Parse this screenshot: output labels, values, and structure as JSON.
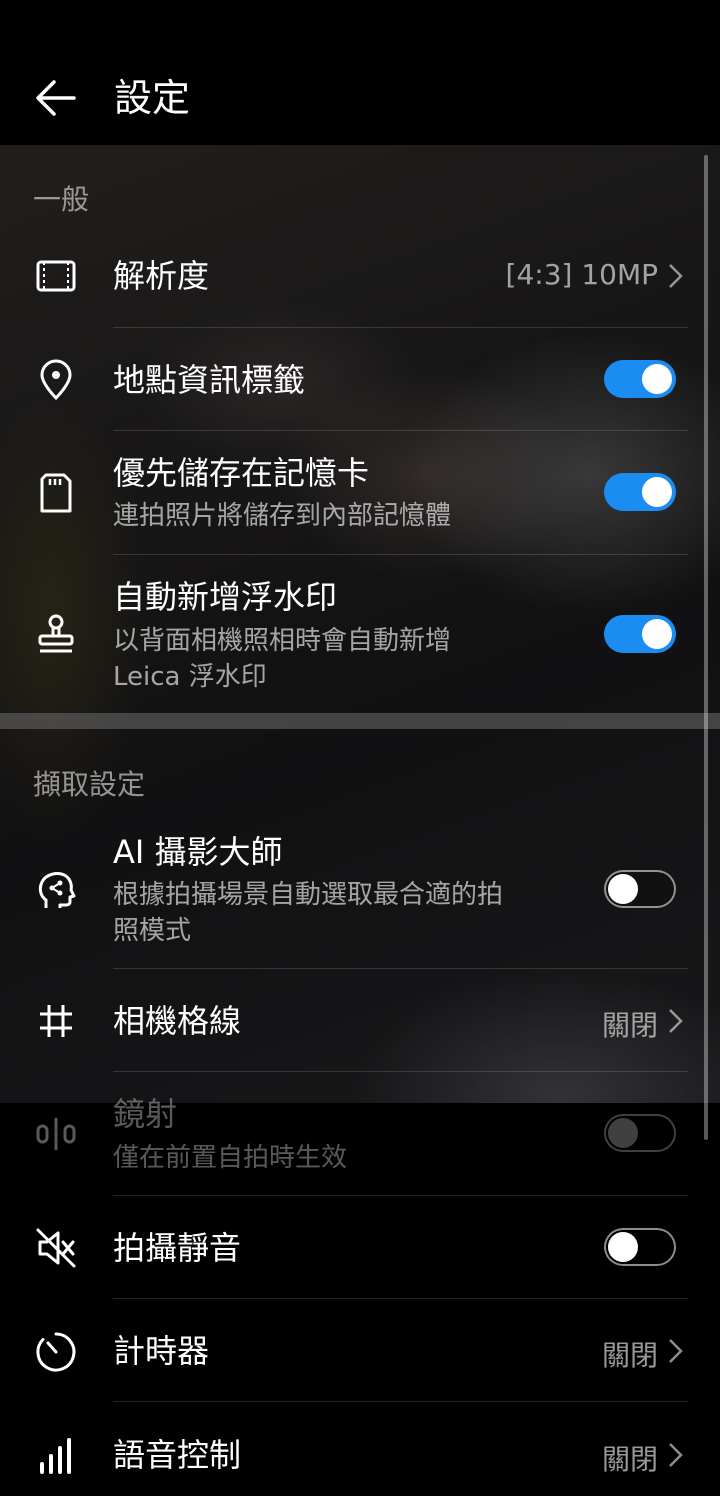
{
  "header": {
    "title": "設定"
  },
  "sections": {
    "general": "一般",
    "capture": "擷取設定"
  },
  "rows": {
    "resolution": {
      "label": "解析度",
      "value": "[4:3] 10MP"
    },
    "location_tag": {
      "label": "地點資訊標籤",
      "toggle": "on"
    },
    "save_sd": {
      "label": "優先儲存在記憶卡",
      "sub": "連拍照片將儲存到內部記憶體",
      "toggle": "on"
    },
    "watermark": {
      "label": "自動新增浮水印",
      "sub_line1": "以背面相機照相時會自動新增",
      "sub_line2": "Leica 浮水印",
      "toggle": "on"
    },
    "ai_master": {
      "label": "AI 攝影大師",
      "sub_line1": "根據拍攝場景自動選取最合適的拍",
      "sub_line2": "照模式",
      "toggle": "off"
    },
    "grid": {
      "label": "相機格線",
      "value": "關閉"
    },
    "mirror": {
      "label": "鏡射",
      "sub": "僅在前置自拍時生效",
      "toggle": "off",
      "disabled": true
    },
    "mute": {
      "label": "拍攝靜音",
      "toggle": "off"
    },
    "timer": {
      "label": "計時器",
      "value": "關閉"
    },
    "voice": {
      "label": "語音控制",
      "value": "關閉"
    }
  },
  "colors": {
    "accent": "#1b8cf1",
    "background": "#000000"
  },
  "icons": [
    "back-arrow-icon",
    "resolution-icon",
    "location-pin-icon",
    "sd-card-icon",
    "stamp-icon",
    "ai-head-icon",
    "grid-icon",
    "mirror-icon",
    "mute-icon",
    "timer-icon",
    "voice-bars-icon",
    "chevron-right-icon"
  ]
}
